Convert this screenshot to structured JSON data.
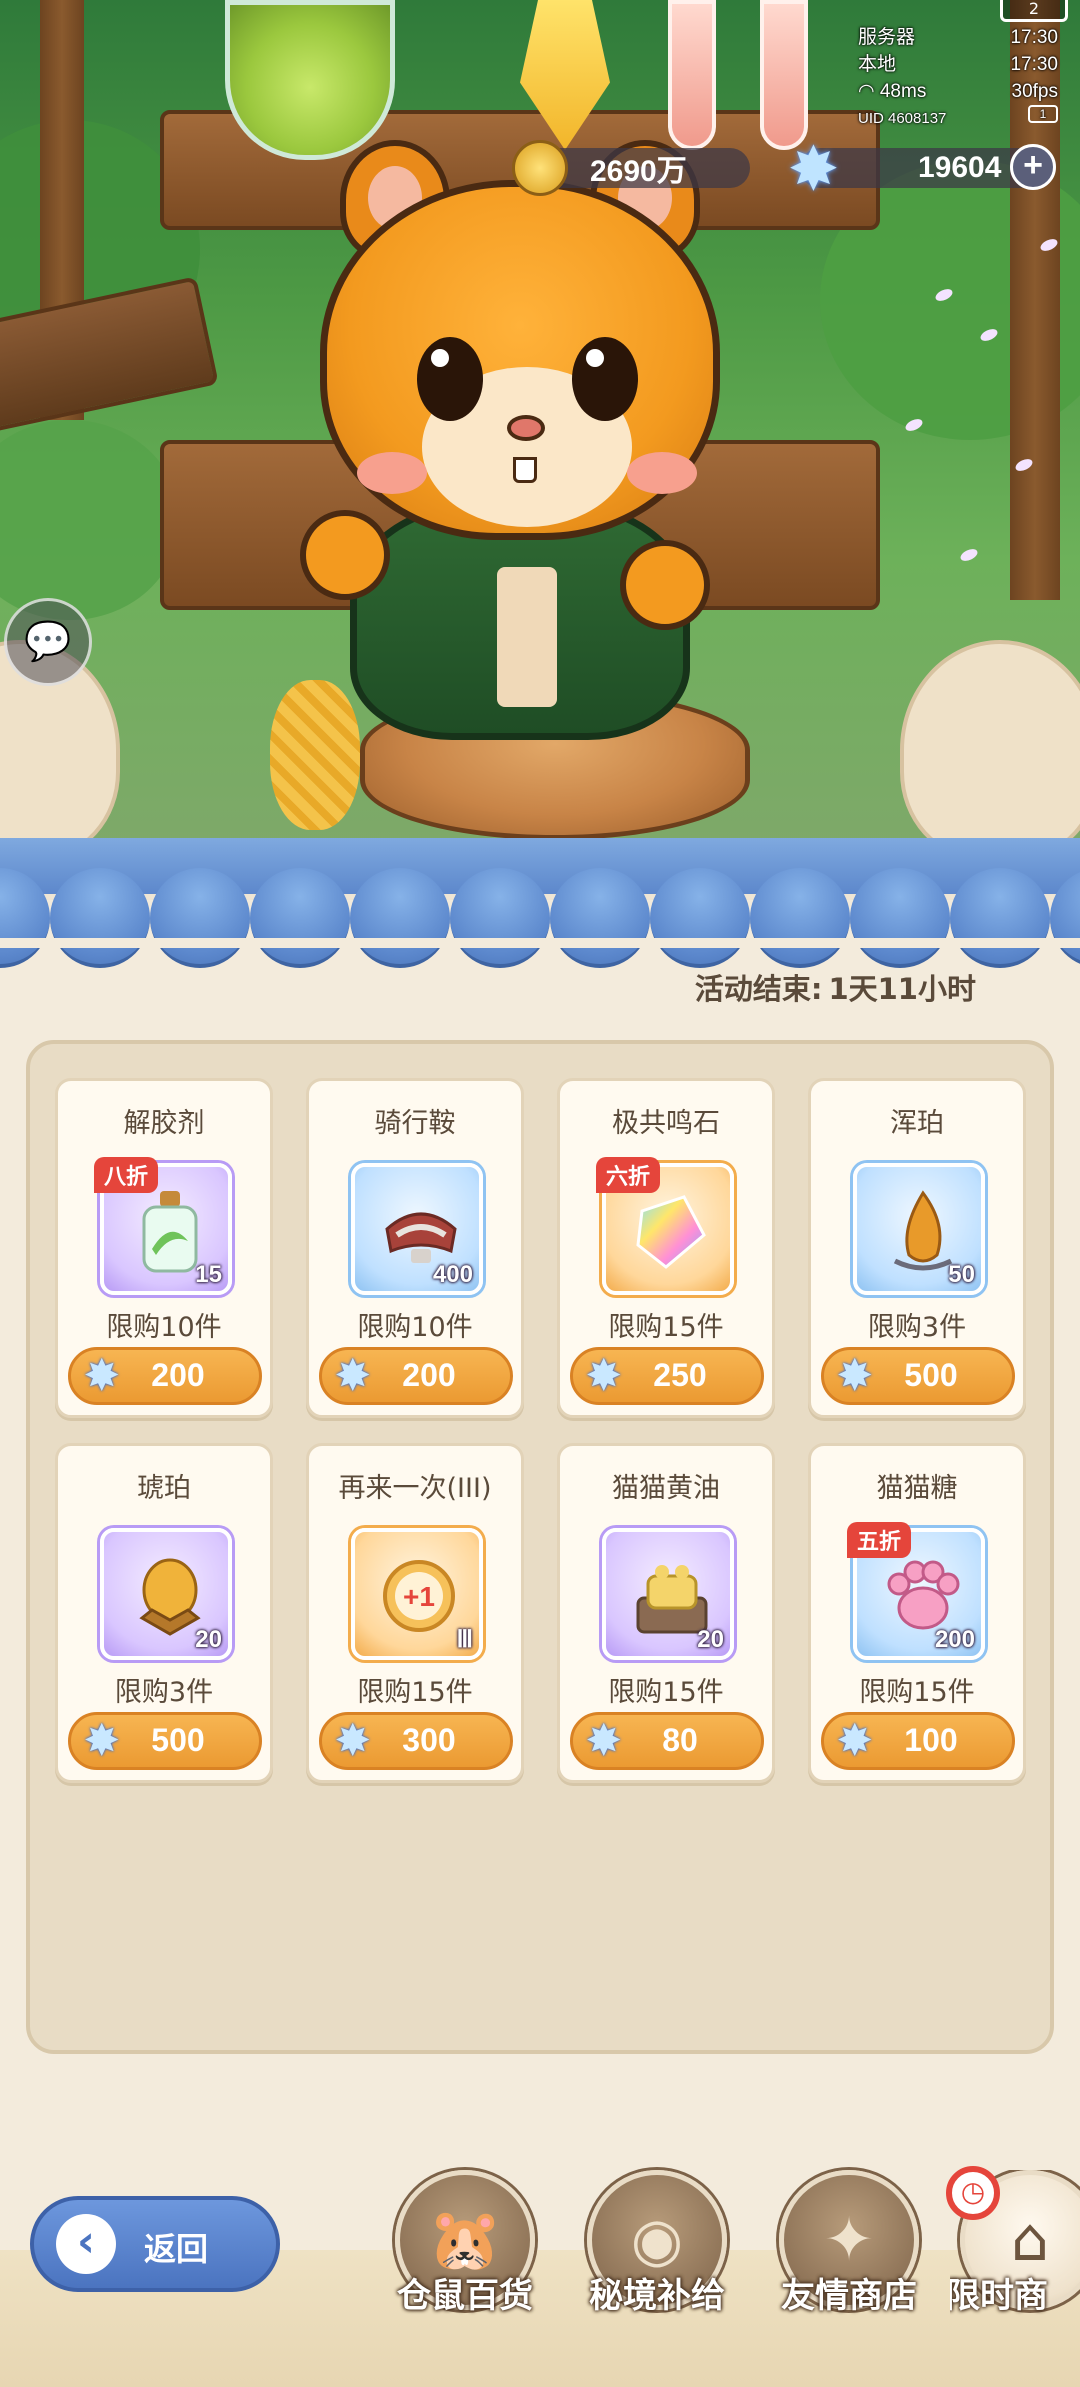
{
  "status": {
    "level": "2",
    "rows": [
      {
        "label": "服务器",
        "value": "17:30"
      },
      {
        "label": "本地",
        "value": "17:30"
      },
      {
        "label": "48ms",
        "value": "30fps"
      }
    ],
    "uid": "UID 4608137",
    "uid_box": "1"
  },
  "currency": {
    "gold": "2690万",
    "stars": "19604",
    "plus": "+"
  },
  "shop": {
    "timer_label": "活动结束:",
    "timer_value": "1天11小时",
    "items": [
      {
        "name": "解胶剂",
        "qty": "15",
        "discount": "八折",
        "limit": "限购10件",
        "price": "200",
        "rarity": "purple",
        "icon": "bottle-icon"
      },
      {
        "name": "骑行鞍",
        "qty": "400",
        "discount": "",
        "limit": "限购10件",
        "price": "200",
        "rarity": "blue",
        "icon": "saddle-icon"
      },
      {
        "name": "极共鸣石",
        "qty": "",
        "discount": "六折",
        "limit": "限购15件",
        "price": "250",
        "rarity": "orange",
        "icon": "crystal-icon"
      },
      {
        "name": "浑珀",
        "qty": "50",
        "discount": "",
        "limit": "限购3件",
        "price": "500",
        "rarity": "blue",
        "icon": "amber-icon"
      },
      {
        "name": "琥珀",
        "qty": "20",
        "discount": "",
        "limit": "限购3件",
        "price": "500",
        "rarity": "purple",
        "icon": "amber-gem-icon"
      },
      {
        "name": "再来一次(III)",
        "qty": "Ⅲ",
        "discount": "",
        "limit": "限购15件",
        "price": "300",
        "rarity": "orange",
        "icon": "plus-one-coin-icon"
      },
      {
        "name": "猫猫黄油",
        "qty": "20",
        "discount": "",
        "limit": "限购15件",
        "price": "80",
        "rarity": "purple",
        "icon": "butter-icon"
      },
      {
        "name": "猫猫糖",
        "qty": "200",
        "discount": "五折",
        "limit": "限购15件",
        "price": "100",
        "rarity": "blue",
        "icon": "paw-candy-icon"
      }
    ]
  },
  "nav": {
    "back_label": "返回",
    "tabs": [
      {
        "label": "仓鼠百货",
        "active": false
      },
      {
        "label": "秘境补给",
        "active": false
      },
      {
        "label": "友情商店",
        "active": false
      },
      {
        "label": "限时商",
        "active": true
      }
    ]
  },
  "colors": {
    "price_button": "#eb9a32",
    "awning": "#5d88cc",
    "discount_badge": "#e5453b",
    "back_button": "#4b74c0"
  }
}
